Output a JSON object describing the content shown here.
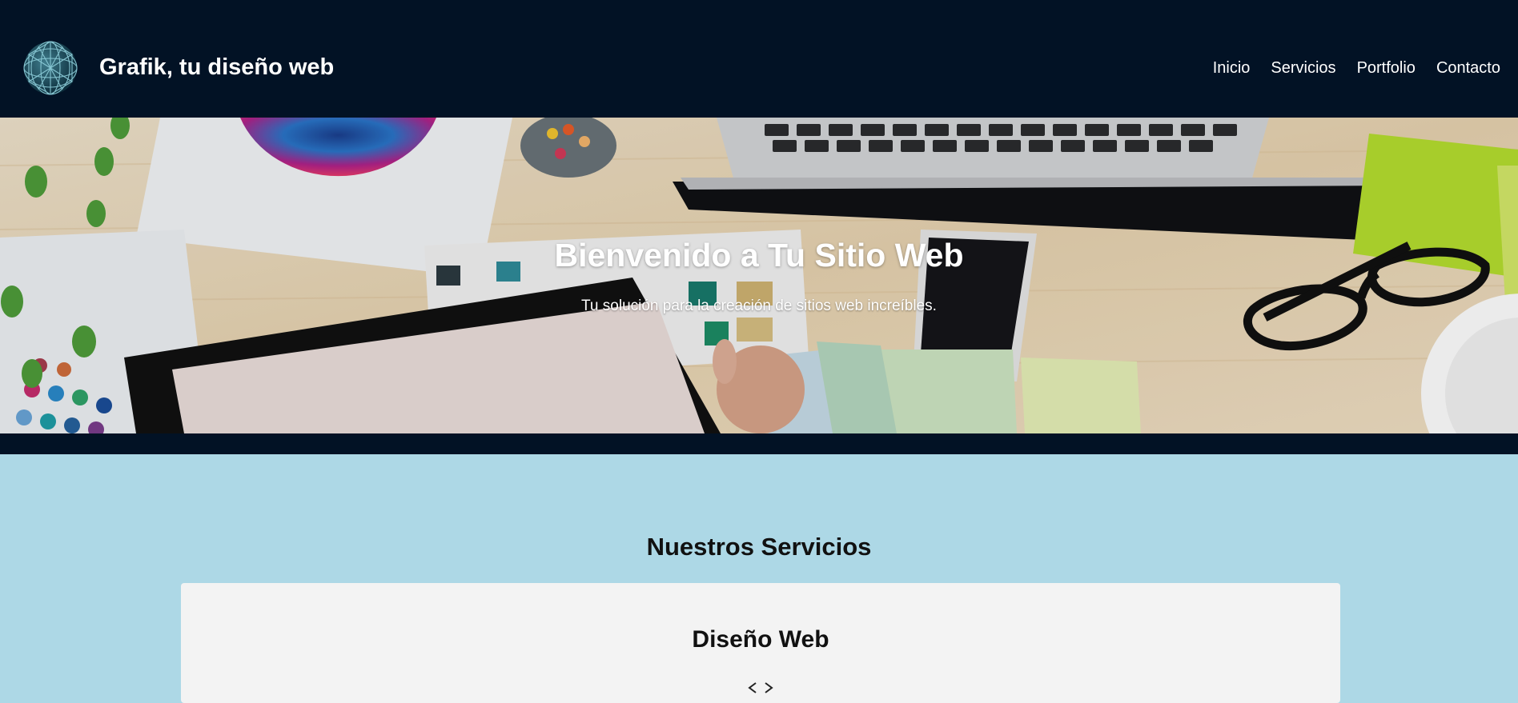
{
  "header": {
    "brand": "Grafik, tu diseño web",
    "logo_icon": "wireframe-globe-icon",
    "nav": [
      {
        "label": "Inicio"
      },
      {
        "label": "Servicios"
      },
      {
        "label": "Portfolio"
      },
      {
        "label": "Contacto"
      }
    ]
  },
  "hero": {
    "title": "Bienvenido a Tu Sitio Web",
    "subtitle": "Tu solución para la creación de sitios web increíbles.",
    "background": "desk-with-laptop-tablet-color-swatches-photo"
  },
  "services": {
    "title": "Nuestros Servicios",
    "cards": [
      {
        "title": "Diseño Web",
        "icon": "code-icon"
      }
    ]
  },
  "colors": {
    "header_bg": "#021225",
    "page_bg": "#add8e6",
    "card_bg": "#f3f3f3",
    "nav_text": "#ffffff"
  }
}
